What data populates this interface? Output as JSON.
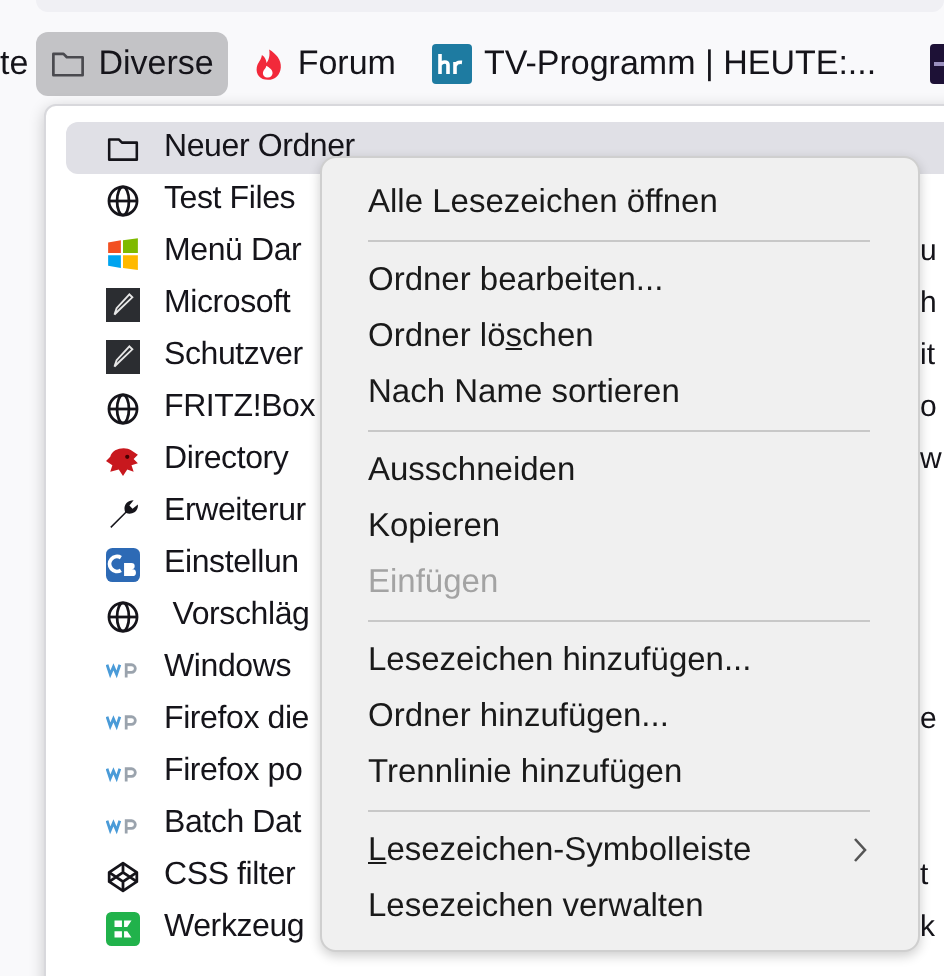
{
  "toolbar": {
    "items": [
      {
        "kind": "text",
        "label": "te",
        "selected": false
      },
      {
        "kind": "folder",
        "label": "Diverse",
        "selected": true
      },
      {
        "kind": "fire",
        "label": "Forum",
        "selected": false
      },
      {
        "kind": "hr",
        "label": "TV-Programm | HEUTE:...",
        "selected": false
      },
      {
        "kind": "dark",
        "selected": false
      }
    ]
  },
  "folder_menu": {
    "items": [
      {
        "kind": "folder",
        "label": "Neuer Ordner",
        "selected": true
      },
      {
        "kind": "globe",
        "label": "Test Files",
        "selected": false
      },
      {
        "kind": "windows",
        "label": "Menü Dar",
        "label_end": "u",
        "selected": false
      },
      {
        "kind": "pen",
        "label": "Microsoft",
        "label_end": "h",
        "selected": false
      },
      {
        "kind": "pen",
        "label": "Schutzver",
        "label_end": "it",
        "selected": false
      },
      {
        "kind": "globe",
        "label": "FRITZ!Box",
        "label_end": "o",
        "selected": false
      },
      {
        "kind": "dragon",
        "label": "Directory",
        "label_end": "w",
        "selected": false
      },
      {
        "kind": "wrench",
        "label": "Erweiterur",
        "selected": false
      },
      {
        "kind": "cb",
        "label": "Einstellun",
        "selected": false
      },
      {
        "kind": "globe",
        "label": " Vorschläg",
        "selected": false
      },
      {
        "kind": "wp",
        "label": "Windows",
        "selected": false
      },
      {
        "kind": "wp",
        "label": "Firefox die",
        "label_end": "e",
        "selected": false
      },
      {
        "kind": "wp",
        "label": "Firefox po",
        "selected": false
      },
      {
        "kind": "wp",
        "label": "Batch Dat",
        "selected": false
      },
      {
        "kind": "cube",
        "label": "CSS filter",
        "label_end": "t",
        "selected": false
      },
      {
        "kind": "green",
        "label": "Werkzeug",
        "label_end": "k",
        "selected": false
      }
    ]
  },
  "context_menu": {
    "items": [
      {
        "kind": "item",
        "label_parts": [
          {
            "text": "Alle Lesezeichen öffnen",
            "underlined": false
          }
        ],
        "disabled": false
      },
      {
        "kind": "separator"
      },
      {
        "kind": "item",
        "label_parts": [
          {
            "text": "Ordner bearbeiten...",
            "underlined": false
          }
        ],
        "disabled": false
      },
      {
        "kind": "item",
        "label_parts": [
          {
            "text": "Ordner lö",
            "underlined": false
          },
          {
            "text": "s",
            "underlined": true
          },
          {
            "text": "chen",
            "underlined": false
          }
        ],
        "disabled": false
      },
      {
        "kind": "item",
        "label_parts": [
          {
            "text": "Nach Name sortieren",
            "underlined": false
          }
        ],
        "disabled": false
      },
      {
        "kind": "separator"
      },
      {
        "kind": "item",
        "label_parts": [
          {
            "text": "Ausschneiden",
            "underlined": false
          }
        ],
        "disabled": false
      },
      {
        "kind": "item",
        "label_parts": [
          {
            "text": "Kopieren",
            "underlined": false
          }
        ],
        "disabled": false
      },
      {
        "kind": "item",
        "label_parts": [
          {
            "text": "Einfügen",
            "underlined": false
          }
        ],
        "disabled": true
      },
      {
        "kind": "separator"
      },
      {
        "kind": "item",
        "label_parts": [
          {
            "text": "Lesezeichen hinzufügen...",
            "underlined": false
          }
        ],
        "disabled": false
      },
      {
        "kind": "item",
        "label_parts": [
          {
            "text": "Ordner hinzufügen...",
            "underlined": false
          }
        ],
        "disabled": false
      },
      {
        "kind": "item",
        "label_parts": [
          {
            "text": "Trennlinie hinzufügen",
            "underlined": false
          }
        ],
        "disabled": false
      },
      {
        "kind": "separator"
      },
      {
        "kind": "submenu",
        "label_parts": [
          {
            "text": "L",
            "underlined": true
          },
          {
            "text": "esezeichen-Symbolleiste",
            "underlined": false
          }
        ],
        "disabled": false
      },
      {
        "kind": "item",
        "label_parts": [
          {
            "text": "Lesezeichen verwalten",
            "underlined": false
          }
        ],
        "disabled": false
      }
    ]
  }
}
